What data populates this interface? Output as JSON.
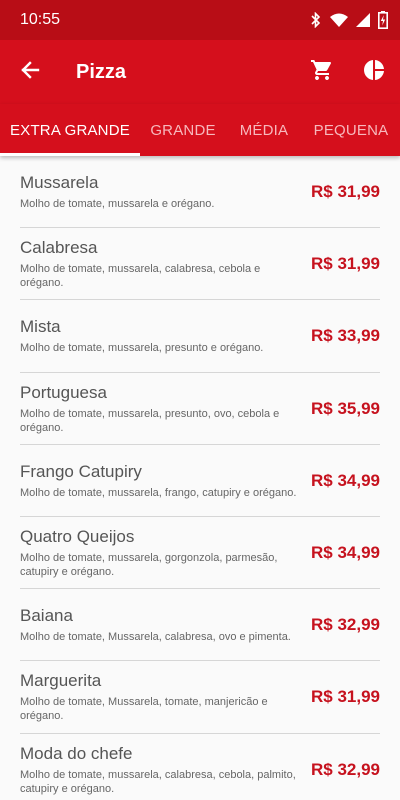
{
  "status": {
    "time": "10:55"
  },
  "app_bar": {
    "title": "Pizza"
  },
  "tabs": [
    {
      "label": "EXTRA GRANDE",
      "active": true
    },
    {
      "label": "GRANDE",
      "active": false
    },
    {
      "label": "MÉDIA",
      "active": false
    },
    {
      "label": "PEQUENA",
      "active": false
    }
  ],
  "items": [
    {
      "name": "Mussarela",
      "desc": "Molho de tomate, mussarela e orégano.",
      "price": "R$ 31,99"
    },
    {
      "name": "Calabresa",
      "desc": "Molho de tomate, mussarela, calabresa, cebola  e orégano.",
      "price": "R$ 31,99"
    },
    {
      "name": "Mista",
      "desc": "Molho de tomate, mussarela, presunto e orégano.",
      "price": "R$ 33,99"
    },
    {
      "name": "Portuguesa",
      "desc": "Molho de tomate, mussarela, presunto, ovo, cebola e orégano.",
      "price": "R$ 35,99"
    },
    {
      "name": "Frango Catupiry",
      "desc": "Molho de tomate, mussarela, frango, catupiry e orégano.",
      "price": "R$ 34,99"
    },
    {
      "name": "Quatro Queijos",
      "desc": "Molho de tomate, mussarela, gorgonzola, parmesão, catupiry e orégano.",
      "price": "R$ 34,99"
    },
    {
      "name": "Baiana",
      "desc": "Molho de tomate, Mussarela, calabresa, ovo e pimenta.",
      "price": "R$ 32,99"
    },
    {
      "name": "Marguerita",
      "desc": "Molho de tomate, Mussarela, tomate, manjericão e orégano.",
      "price": "R$ 31,99"
    },
    {
      "name": "Moda do chefe",
      "desc": "Molho de tomate, mussarela, calabresa, cebola, palmito, catupiry e orégano.",
      "price": "R$ 32,99"
    }
  ],
  "colors": {
    "primary": "#d50f1c",
    "primary_dark": "#b80d16",
    "price": "#c6121e"
  },
  "icons": {
    "back": "arrow-back-icon",
    "cart": "cart-icon",
    "chart": "pie-chart-icon"
  }
}
